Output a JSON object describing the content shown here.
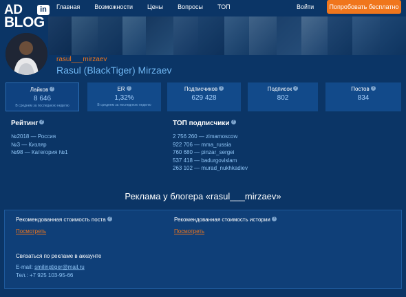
{
  "header": {
    "logo_ad": "AD",
    "logo_in": "in",
    "logo_blog": "BLOG",
    "nav": [
      "Главная",
      "Возможности",
      "Цены",
      "Вопросы",
      "ТОП"
    ],
    "login": "Войти",
    "cta": "Попробовать бесплатно"
  },
  "profile": {
    "username": "rasul___mirzaev",
    "fullname": "Rasul (BlackTiger) Mirzaev"
  },
  "stats": [
    {
      "label": "Лайков",
      "value": "8 646",
      "sub": "В среднем за последнюю неделю"
    },
    {
      "label": "ER",
      "value": "1,32%",
      "sub": "В среднем за последнюю неделю"
    },
    {
      "label": "Подписчиков",
      "value": "629 428"
    },
    {
      "label": "Подписок",
      "value": "802"
    },
    {
      "label": "Постов",
      "value": "834"
    }
  ],
  "rating": {
    "title": "Рейтинг",
    "items": [
      "№2018 — Россия",
      "№3 — Кизляр",
      "№98 — Категория №1"
    ]
  },
  "top_followers": {
    "title": "ТОП подписчики",
    "items": [
      "2 756 260 — zimamoscow",
      "922 706 — mma_russia",
      "760 680 — pinzar_sergei",
      "537 418 — badurgovislam",
      "263 102 — murad_nukhkadiev"
    ]
  },
  "ads": {
    "heading": "Реклама у блогера «rasul___mirzaev»",
    "post_cost_label": "Рекомендованная стоимость поста",
    "post_cost_link": "Посмотреть",
    "story_cost_label": "Рекомендованная стоимость истории",
    "story_cost_link": "Посмотреть",
    "contact_title": "Связаться по рекламе в аккаунте",
    "email_label": "E-mail:",
    "email": "smilingtiger@mail.ru",
    "phone": "Тел.: +7 925 103-95-66"
  },
  "colors": {
    "background": "#0b3566",
    "accent": "#f0761c",
    "link_blue": "#8ec4f5"
  }
}
